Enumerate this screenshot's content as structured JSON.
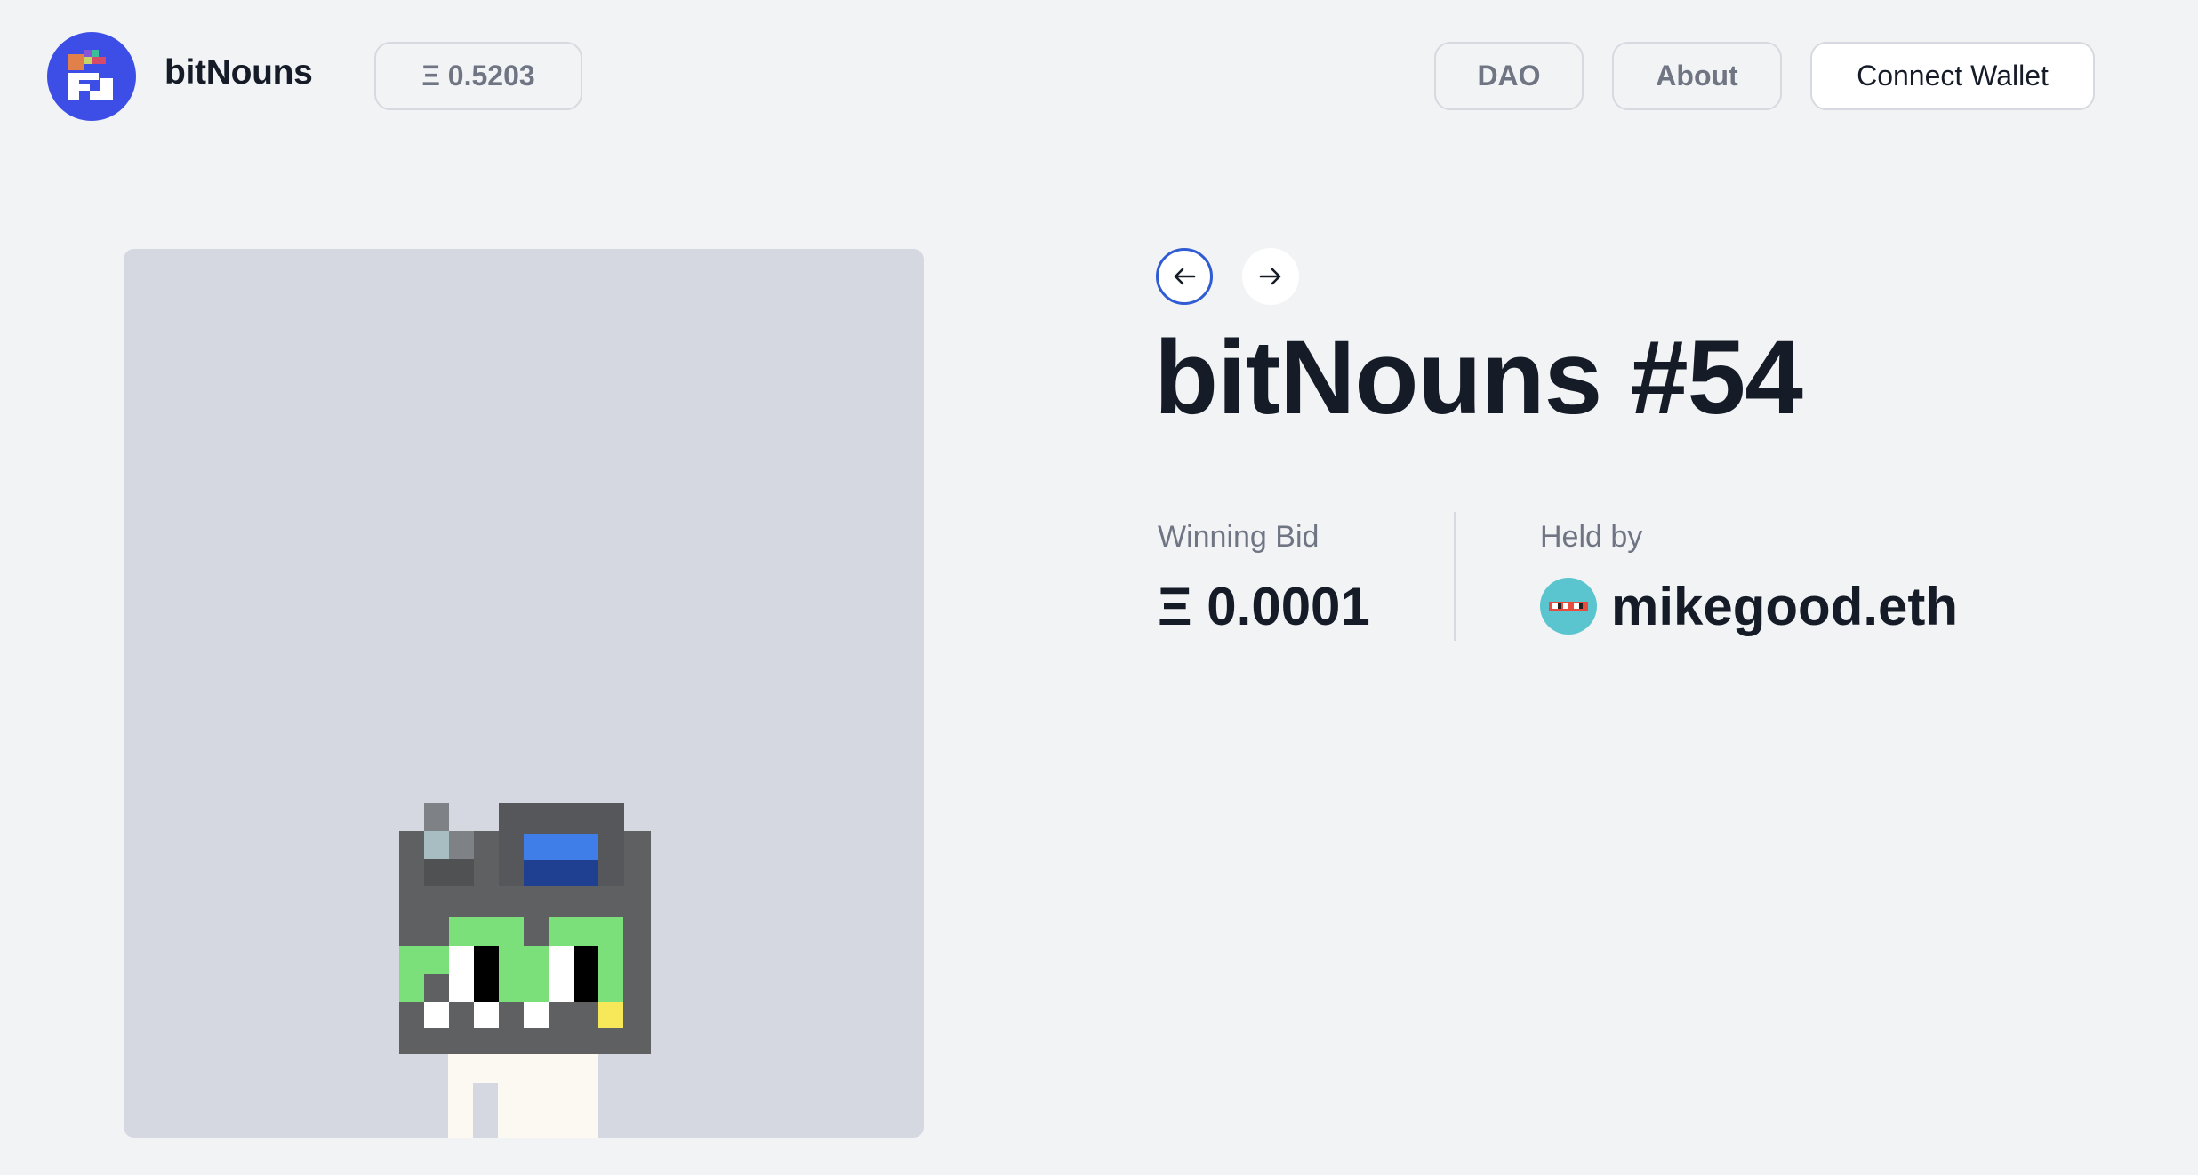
{
  "header": {
    "brand": "bitNouns",
    "treasury": "Ξ 0.5203",
    "nav": {
      "dao": "DAO",
      "about": "About",
      "connect": "Connect Wallet"
    }
  },
  "auction": {
    "title": "bitNouns #54",
    "winning_bid_label": "Winning Bid",
    "winning_bid_value": "Ξ 0.0001",
    "held_by_label": "Held by",
    "holder": "mikegood.eth"
  },
  "icons": {
    "logo": "bitnouns-logo-icon",
    "prev": "arrow-left-icon",
    "next": "arrow-right-icon",
    "avatar": "holder-avatar-icon"
  },
  "colors": {
    "background": "#f2f3f5",
    "art_background": "#d5d7e1",
    "logo_background": "#3c4ee6",
    "prev_arrow_ring": "#2f5bd3",
    "avatar_background": "#5bc5cf"
  }
}
